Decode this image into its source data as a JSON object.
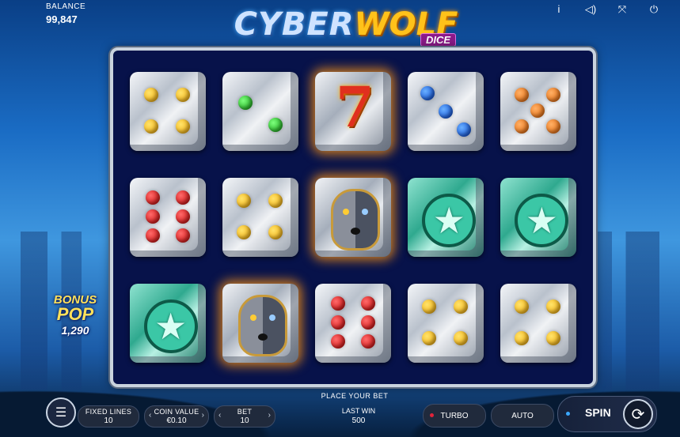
{
  "balance": {
    "label": "BALANCE",
    "value": "99,847"
  },
  "top_icons": [
    "info-icon",
    "sound-icon",
    "fullscreen-icon",
    "power-icon"
  ],
  "logo": {
    "word1": "CYBER",
    "word2": "WOLF",
    "sub": "DICE"
  },
  "reels": [
    [
      "die-4-yellow",
      "die-2-green",
      "seven",
      "die-3-blue",
      "die-5-orange"
    ],
    [
      "die-6-red",
      "die-4-yellow",
      "wolf",
      "star",
      "star"
    ],
    [
      "star",
      "wolf",
      "die-6-red",
      "die-4-yellow",
      "die-4-yellow"
    ]
  ],
  "bonus": {
    "line1": "BONUS",
    "line2": "POP",
    "amount": "1,290"
  },
  "bottom": {
    "prompt": "PLACE YOUR BET",
    "fixed_lines": {
      "label": "FIXED LINES",
      "value": "10"
    },
    "coin_value": {
      "label": "COIN VALUE",
      "value": "€0.10"
    },
    "bet": {
      "label": "BET",
      "value": "10"
    },
    "last_win": {
      "label": "LAST WIN",
      "value": "500"
    },
    "turbo": "TURBO",
    "auto": "AUTO",
    "spin": "SPIN"
  }
}
